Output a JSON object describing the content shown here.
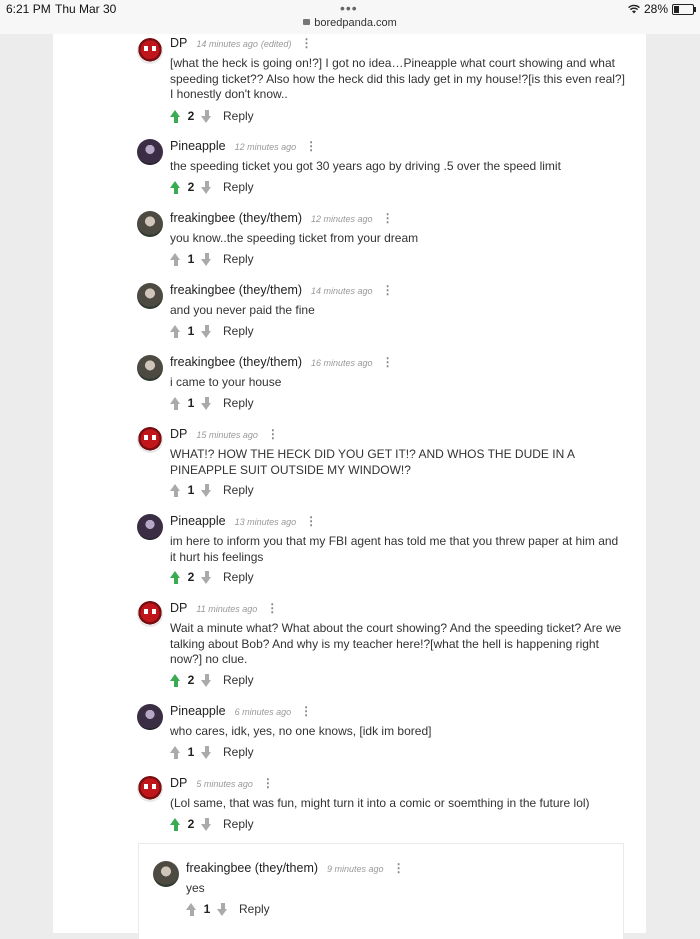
{
  "status_bar": {
    "time": "6:21 PM",
    "day": "Thu Mar 30",
    "url": "boredpanda.com",
    "battery": "28%"
  },
  "comments": [
    {
      "author": "DP",
      "time": "14 minutes ago",
      "edited": "(edited)",
      "text": "[what the heck is going on!?] I got no idea…Pineapple what court showing and what speeding ticket?? Also how the heck did this lady get in my house!?[is this even real?] I honestly don't know..",
      "votes": "2",
      "reply": "Reply"
    },
    {
      "author": "Pineapple",
      "time": "12 minutes ago",
      "text": "the speeding ticket you got 30 years ago by driving .5 over the speed limit",
      "votes": "2",
      "reply": "Reply"
    },
    {
      "author": "freakingbee (they/them)",
      "time": "12 minutes ago",
      "text": "you know..the speeding ticket from your dream",
      "votes": "1",
      "reply": "Reply"
    },
    {
      "author": "freakingbee (they/them)",
      "time": "14 minutes ago",
      "text": "and you never paid the fine",
      "votes": "1",
      "reply": "Reply"
    },
    {
      "author": "freakingbee (they/them)",
      "time": "16 minutes ago",
      "text": "i came to your house",
      "votes": "1",
      "reply": "Reply"
    },
    {
      "author": "DP",
      "time": "15 minutes ago",
      "text": "WHAT!? HOW THE HECK DID YOU GET IT!? AND WHOS THE DUDE IN A PINEAPPLE SUIT OUTSIDE MY WINDOW!?",
      "votes": "1",
      "reply": "Reply"
    },
    {
      "author": "Pineapple",
      "time": "13 minutes ago",
      "text": "im here to inform you that my FBI agent has told me that you threw paper at him and it hurt his feelings",
      "votes": "2",
      "reply": "Reply"
    },
    {
      "author": "DP",
      "time": "11 minutes ago",
      "text": "Wait a minute what? What about the court showing? And the speeding ticket? Are we talking about Bob? And why is my teacher here!?[what the hell is happening right now?] no clue.",
      "votes": "2",
      "reply": "Reply"
    },
    {
      "author": "Pineapple",
      "time": "6 minutes ago",
      "text": "who cares, idk, yes, no one knows, [idk im bored]",
      "votes": "1",
      "reply": "Reply"
    },
    {
      "author": "DP",
      "time": "5 minutes ago",
      "text": "(Lol same, that was fun, might turn it into a comic or soemthing in the future lol)",
      "votes": "2",
      "reply": "Reply"
    },
    {
      "author": "freakingbee (they/them)",
      "time": "9 minutes ago",
      "text": "yes",
      "votes": "1",
      "reply": "Reply"
    }
  ],
  "colors": {
    "upvote_active": "#3aab51",
    "vote_inactive": "#aaaaaa",
    "background": "#ececec"
  },
  "icons": {
    "upvote": "arrow-up-icon",
    "downvote": "arrow-down-icon",
    "menu": "vertical-ellipsis-icon",
    "lock": "lock-icon",
    "wifi": "wifi-icon",
    "battery": "battery-icon"
  }
}
